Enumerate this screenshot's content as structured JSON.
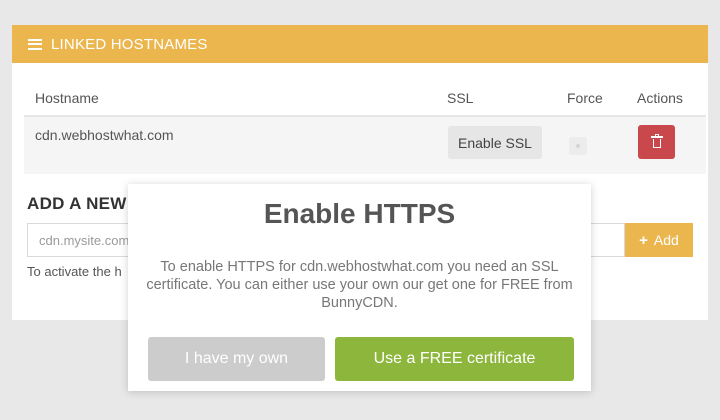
{
  "panel": {
    "title": "LINKED HOSTNAMES",
    "header_color": "#ecb64e"
  },
  "table": {
    "columns": [
      "Hostname",
      "SSL",
      "Force",
      "Actions"
    ],
    "rows": [
      {
        "hostname": "cdn.webhostwhat.com",
        "ssl_button": "Enable SSL",
        "force": false,
        "action_icon": "trash-icon"
      }
    ]
  },
  "add": {
    "title": "ADD A NEW",
    "placeholder": "cdn.mysite.com",
    "button_label": "Add",
    "hint": "To activate the h"
  },
  "modal": {
    "title": "Enable HTTPS",
    "text": "To enable HTTPS for cdn.webhostwhat.com you need an SSL certificate. You can either use your own our get one for FREE from BunnyCDN.",
    "own_button": "I have my own",
    "free_button": "Use a FREE certificate",
    "free_color": "#8cb63c"
  }
}
